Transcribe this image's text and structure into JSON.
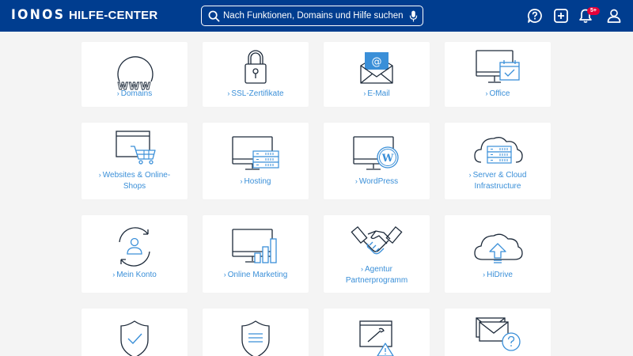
{
  "header": {
    "logo": "IONOS",
    "title": "HILFE-CENTER",
    "search_placeholder": "Nach Funktionen, Domains und Hilfe suchen",
    "notification_badge": "5+"
  },
  "colors": {
    "header_bg": "#003d8f",
    "icon_stroke": "#1d2a3a",
    "icon_accent": "#3a8fd8",
    "link": "#3a8fd8",
    "badge": "#e4003a"
  },
  "tiles": [
    {
      "label": "Domains",
      "icon": "globe-www-icon"
    },
    {
      "label": "SSL-Zertifikate",
      "icon": "padlock-icon"
    },
    {
      "label": "E-Mail",
      "icon": "envelope-at-icon"
    },
    {
      "label": "Office",
      "icon": "monitor-calendar-icon"
    },
    {
      "label": "Websites & Online-Shops",
      "icon": "browser-cart-icon"
    },
    {
      "label": "Hosting",
      "icon": "monitor-server-icon"
    },
    {
      "label": "WordPress",
      "icon": "monitor-wordpress-icon"
    },
    {
      "label": "Server & Cloud Infrastructure",
      "icon": "cloud-server-icon"
    },
    {
      "label": "Mein Konto",
      "icon": "user-cycle-icon"
    },
    {
      "label": "Online Marketing",
      "icon": "monitor-chart-icon"
    },
    {
      "label": "Agentur Partnerprogramm",
      "icon": "handshake-icon"
    },
    {
      "label": "HiDrive",
      "icon": "cloud-upload-icon"
    },
    {
      "label": "",
      "icon": "shield-check-icon"
    },
    {
      "label": "",
      "icon": "shield-list-icon"
    },
    {
      "label": "",
      "icon": "window-warning-icon"
    },
    {
      "label": "",
      "icon": "envelope-question-icon"
    }
  ]
}
